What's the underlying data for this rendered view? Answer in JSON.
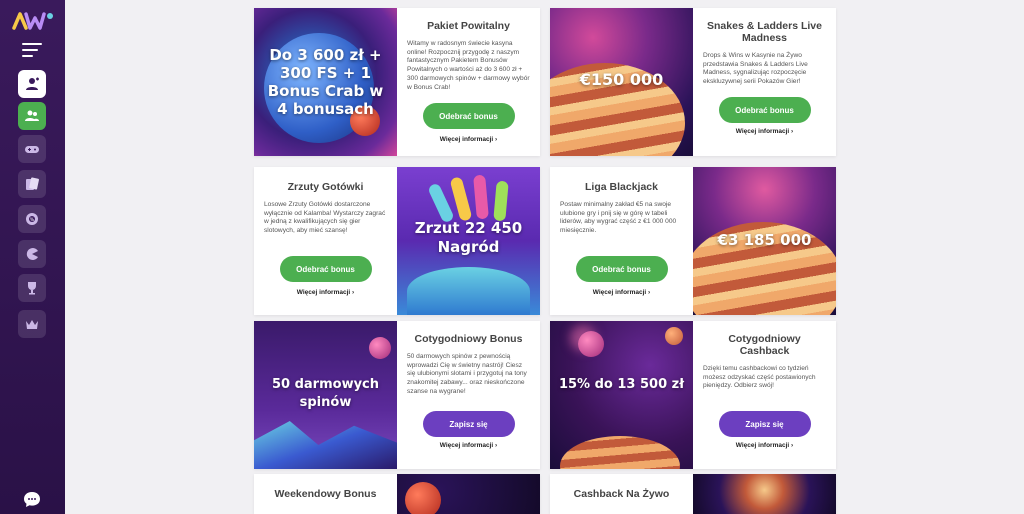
{
  "sidebar": {
    "logo": "AW",
    "nav": [
      {
        "icon": "user-add-icon"
      },
      {
        "icon": "users-icon"
      },
      {
        "icon": "gamepad-icon"
      },
      {
        "icon": "cards-icon"
      },
      {
        "icon": "chip-icon"
      },
      {
        "icon": "pacman-icon"
      },
      {
        "icon": "trophy-icon"
      },
      {
        "icon": "crown-icon"
      }
    ]
  },
  "cards": [
    {
      "title": "Pakiet Powitalny",
      "desc": "Witamy w radosnym świecie kasyna online! Rozpocznij przygodę z naszym fantastycznym Pakietem Bonusów Powitalnych o wartości aż do 3 600 zł + 300 darmowych spinów + darmowy wybór w Bonus Crab!",
      "image_text": "Do 3 600 zł + 300 FS + 1 Bonus Crab w 4 bonusach",
      "button": "Odebrać bonus",
      "more": "Więcej informacji"
    },
    {
      "title": "Snakes & Ladders Live Madness",
      "desc": "Drops & Wins w Kasynie na Żywo przedstawia Snakes & Ladders Live Madness, sygnalizując rozpoczęcie ekskluzywnej serii Pokazów Gier!",
      "image_text": "€150 000",
      "button": "Odebrać bonus",
      "more": "Więcej informacji"
    },
    {
      "title": "Zrzuty Gotówki",
      "desc": "Losowe Zrzuty Gotówki dostarczone wyłącznie od Kalamba! Wystarczy zagrać w jedną z kwalifikujących się gier slotowych, aby mieć szansę!",
      "image_text": "Zrzut 22 450 Nagród",
      "button": "Odebrać bonus",
      "more": "Więcej informacji"
    },
    {
      "title": "Liga Blackjack",
      "desc": "Postaw minimalny zakład €5 na swoje ulubione gry i pnij się w górę w tabeli liderów, aby wygrać część z €1 000 000 miesięcznie.",
      "image_text": "€3 185 000",
      "button": "Odebrać bonus",
      "more": "Więcej informacji"
    },
    {
      "title": "Cotygodniowy Bonus",
      "desc": "50 darmowych spinów z pewnością wprowadzi Cię w świetny nastrój! Ciesz się ulubionymi slotami i przygotuj na tony znakomitej zabawy... oraz nieskończone szanse na wygrane!",
      "image_text": "50 darmowych spinów",
      "button": "Zapisz się",
      "more": "Więcej informacji"
    },
    {
      "title": "Cotygodniowy Cashback",
      "desc": "Dzięki temu cashbackowi co tydzień możesz odzyskać część postawionych pieniędzy. Odbierz swój!",
      "image_text": "15% do 13 500 zł",
      "button": "Zapisz się",
      "more": "Więcej informacji"
    },
    {
      "title": "Weekendowy Bonus"
    },
    {
      "title": "Cashback Na Żywo"
    }
  ]
}
